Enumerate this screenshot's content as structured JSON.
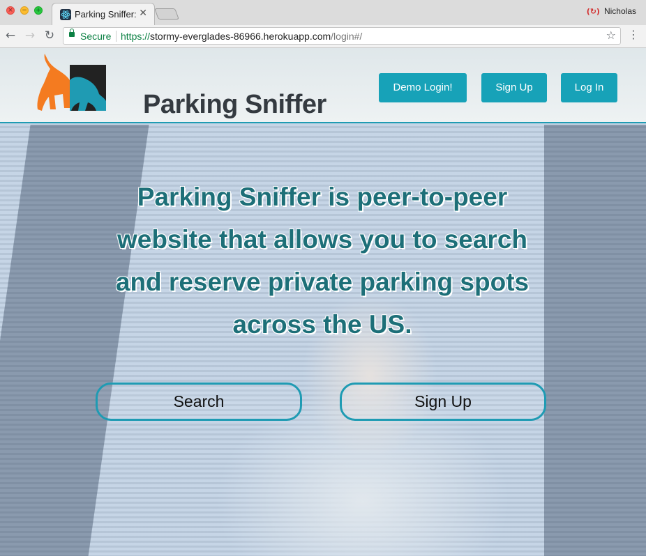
{
  "browser": {
    "tab_title": "Parking Sniffer: ",
    "tab_close": "✕",
    "profile_name": "Nicholas",
    "secure_label": "Secure",
    "url_scheme": "https://",
    "url_host": "stormy-everglades-86966.herokuapp.com",
    "url_path": "/login#/",
    "back_icon": "←",
    "forward_icon": "→",
    "reload_icon": "↻",
    "star_icon": "☆",
    "menu_icon": "⋮"
  },
  "header": {
    "logo_text": "Parking Sniffer",
    "demo_login_label": "Demo Login!",
    "signup_label": "Sign Up",
    "login_label": "Log In"
  },
  "hero": {
    "text": "Parking Sniffer is peer-to-peer website that allows you to search and reserve private parking spots across the US.",
    "search_label": "Search",
    "signup_label": "Sign Up"
  },
  "colors": {
    "accent": "#17a2b8",
    "hero_text": "#1d6f78",
    "logo_orange": "#f47b20",
    "logo_blue": "#1f9bb3"
  }
}
